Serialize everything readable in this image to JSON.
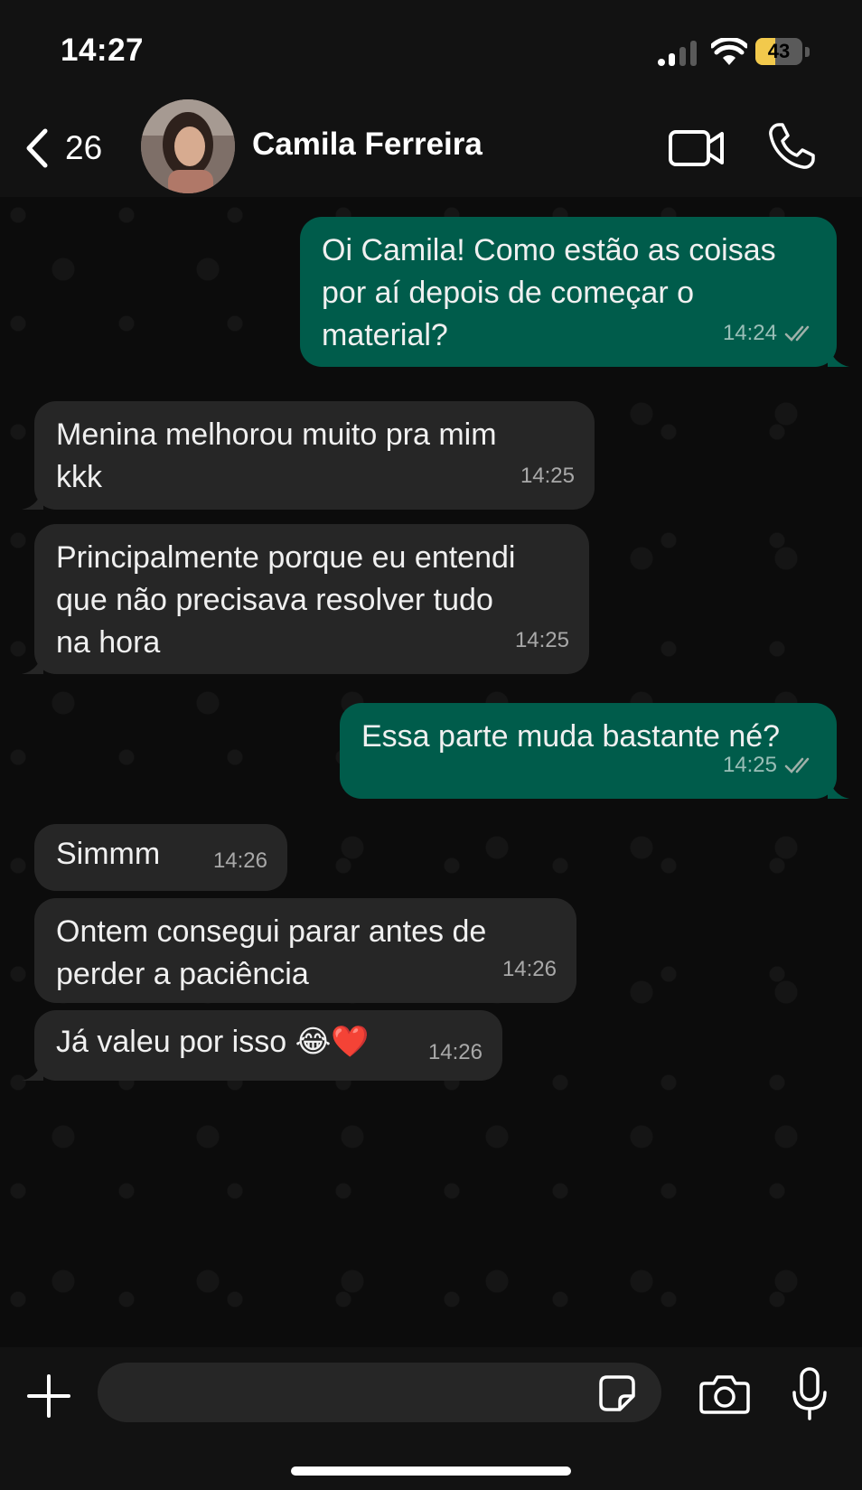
{
  "status_bar": {
    "time": "14:27",
    "battery_level": "43",
    "battery_color": "#f2c94c"
  },
  "header": {
    "back_icon": "chevron-left-icon",
    "unread_count": "26",
    "contact_name": "Camila Ferreira",
    "video_icon": "video-camera-icon",
    "call_icon": "phone-icon"
  },
  "colors": {
    "outgoing_bubble": "#005c4b",
    "incoming_bubble": "#262626",
    "background": "#0c0c0c",
    "read_ticks": "#9fb0a9"
  },
  "messages": [
    {
      "direction": "out",
      "text": "Oi Camila! Como estão as coisas\npor aí depois de começar o\nmaterial?",
      "time": "14:24",
      "status": "read"
    },
    {
      "direction": "in",
      "text": "Menina melhorou muito pra mim\nkkk",
      "time": "14:25"
    },
    {
      "direction": "in",
      "text": "Principalmente porque eu entendi\nque não precisava resolver tudo\nna hora",
      "time": "14:25"
    },
    {
      "direction": "out",
      "text": "Essa parte muda bastante né?",
      "time": "14:25",
      "status": "read"
    },
    {
      "direction": "in",
      "text": "Simmm",
      "time": "14:26"
    },
    {
      "direction": "in",
      "text": "Ontem consegui parar antes de\nperder a paciência",
      "time": "14:26"
    },
    {
      "direction": "in",
      "text": "Já valeu por isso ",
      "emoji": "😂❤️",
      "time": "14:26"
    }
  ],
  "input_bar": {
    "plus_icon": "plus-icon",
    "placeholder": "",
    "sticker_icon": "sticker-icon",
    "camera_icon": "camera-icon",
    "mic_icon": "microphone-icon"
  }
}
